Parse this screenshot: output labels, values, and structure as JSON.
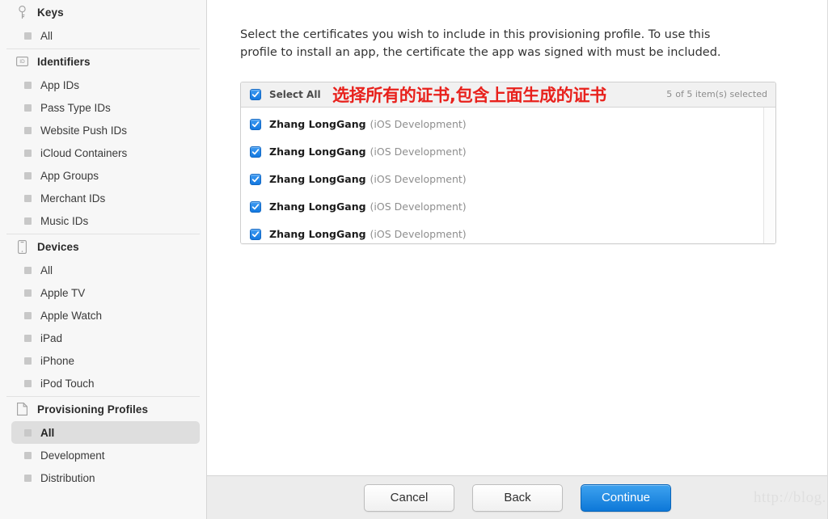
{
  "sidebar": {
    "groups": [
      {
        "title": "Keys",
        "icon": "key-icon",
        "items": [
          {
            "label": "All",
            "selected": false
          }
        ]
      },
      {
        "title": "Identifiers",
        "icon": "id-badge-icon",
        "items": [
          {
            "label": "App IDs",
            "selected": false
          },
          {
            "label": "Pass Type IDs",
            "selected": false
          },
          {
            "label": "Website Push IDs",
            "selected": false
          },
          {
            "label": "iCloud Containers",
            "selected": false
          },
          {
            "label": "App Groups",
            "selected": false
          },
          {
            "label": "Merchant IDs",
            "selected": false
          },
          {
            "label": "Music IDs",
            "selected": false
          }
        ]
      },
      {
        "title": "Devices",
        "icon": "phone-icon",
        "items": [
          {
            "label": "All",
            "selected": false
          },
          {
            "label": "Apple TV",
            "selected": false
          },
          {
            "label": "Apple Watch",
            "selected": false
          },
          {
            "label": "iPad",
            "selected": false
          },
          {
            "label": "iPhone",
            "selected": false
          },
          {
            "label": "iPod Touch",
            "selected": false
          }
        ]
      },
      {
        "title": "Provisioning Profiles",
        "icon": "document-icon",
        "items": [
          {
            "label": "All",
            "selected": true
          },
          {
            "label": "Development",
            "selected": false
          },
          {
            "label": "Distribution",
            "selected": false
          }
        ]
      }
    ]
  },
  "main": {
    "intro": "Select the certificates you wish to include in this provisioning profile. To use this profile to install an app, the certificate the app was signed with must be included.",
    "cert_list": {
      "select_all_label": "Select All",
      "select_all_checked": true,
      "annotation": "选择所有的证书,包含上面生成的证书",
      "selected_count": "5",
      "count_suffix": "of 5 item(s) selected",
      "rows": [
        {
          "name": "Zhang LongGang",
          "kind": "(iOS Development)",
          "checked": true
        },
        {
          "name": "Zhang LongGang",
          "kind": "(iOS Development)",
          "checked": true
        },
        {
          "name": "Zhang LongGang",
          "kind": "(iOS Development)",
          "checked": true
        },
        {
          "name": "Zhang LongGang",
          "kind": "(iOS Development)",
          "checked": true
        },
        {
          "name": "Zhang LongGang",
          "kind": "(iOS Development)",
          "checked": true
        }
      ]
    }
  },
  "footer": {
    "cancel_label": "Cancel",
    "back_label": "Back",
    "continue_label": "Continue",
    "watermark": "http://blog. csdn. net/SayHelloToSun"
  },
  "colors": {
    "accent_blue": "#1479e0",
    "annotation_red": "#e8211c",
    "sidebar_bg": "#f7f7f7",
    "footer_bg": "#ececec"
  }
}
